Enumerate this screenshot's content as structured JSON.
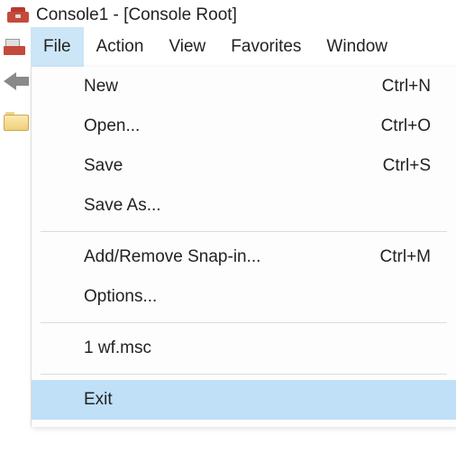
{
  "title": "Console1 - [Console Root]",
  "menubar": {
    "file": "File",
    "action": "Action",
    "view": "View",
    "favorites": "Favorites",
    "window": "Window"
  },
  "file_menu": {
    "new": {
      "label": "New",
      "shortcut": "Ctrl+N"
    },
    "open": {
      "label": "Open...",
      "shortcut": "Ctrl+O"
    },
    "save": {
      "label": "Save",
      "shortcut": "Ctrl+S"
    },
    "save_as": {
      "label": "Save As..."
    },
    "add_remove": {
      "label": "Add/Remove Snap-in...",
      "shortcut": "Ctrl+M"
    },
    "options": {
      "label": "Options..."
    },
    "recent1": {
      "label": "1 wf.msc"
    },
    "exit": {
      "label": "Exit"
    }
  }
}
